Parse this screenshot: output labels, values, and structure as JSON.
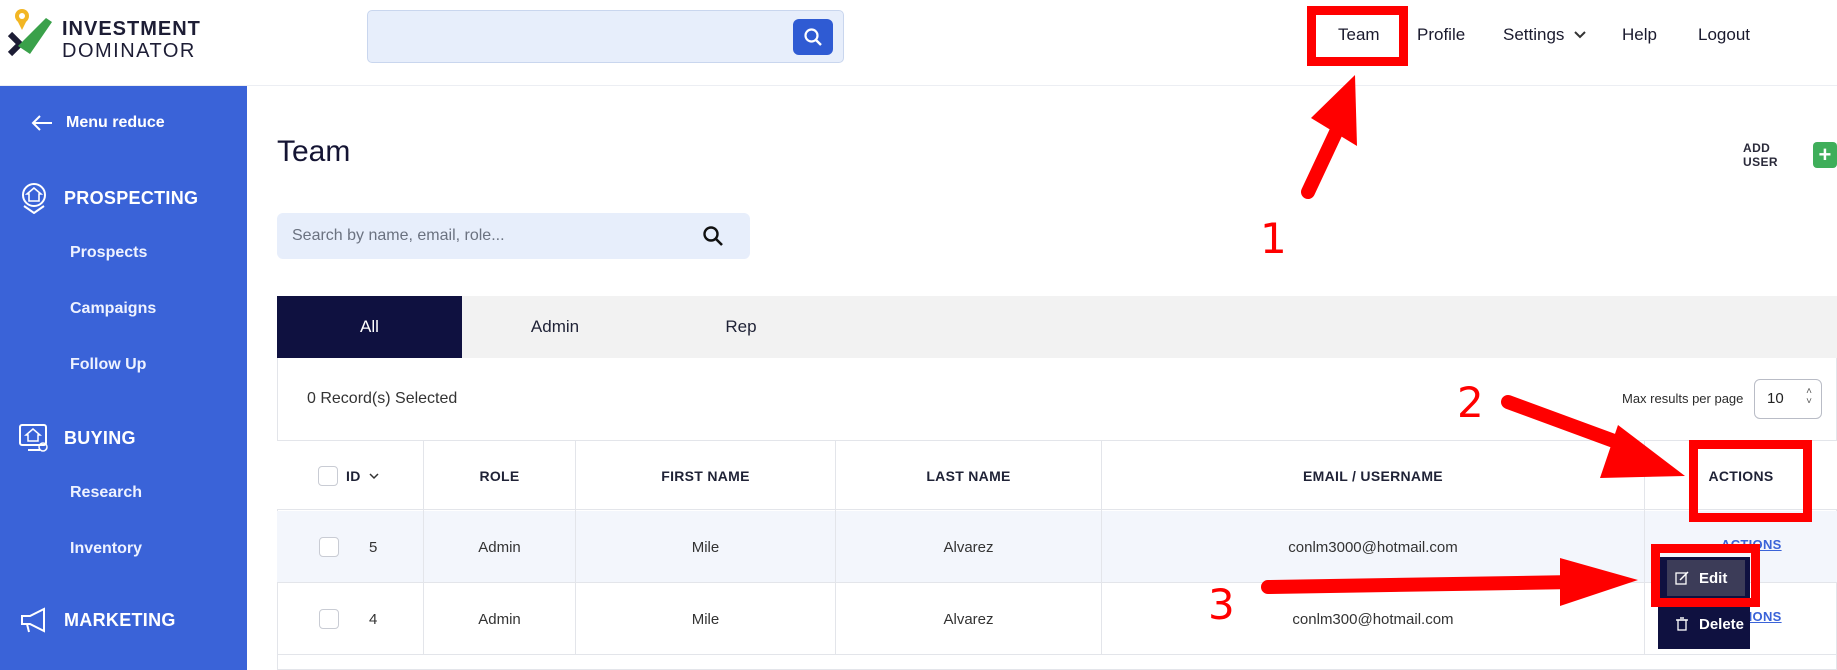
{
  "logo": {
    "line1": "INVESTMENT",
    "line2": "DOMINATOR"
  },
  "nav": {
    "team": "Team",
    "profile": "Profile",
    "settings": "Settings",
    "help": "Help",
    "logout": "Logout"
  },
  "sidebar": {
    "menu_reduce": "Menu reduce",
    "sections": [
      {
        "label": "PROSPECTING",
        "items": [
          "Prospects",
          "Campaigns",
          "Follow Up"
        ]
      },
      {
        "label": "BUYING",
        "items": [
          "Research",
          "Inventory"
        ]
      },
      {
        "label": "MARKETING",
        "items": []
      }
    ]
  },
  "main": {
    "title": "Team",
    "add_user": "ADD USER",
    "search_placeholder": "Search by name, email, role...",
    "tabs": [
      "All",
      "Admin",
      "Rep"
    ],
    "active_tab": "All",
    "selected_text": "0 Record(s) Selected",
    "max_results_label": "Max results per page",
    "page_size": "10"
  },
  "table": {
    "headers": [
      "ID",
      "ROLE",
      "FIRST NAME",
      "LAST NAME",
      "EMAIL / USERNAME",
      "ACTIONS"
    ],
    "rows": [
      {
        "id": "5",
        "role": "Admin",
        "first": "Mile",
        "last": "Alvarez",
        "email": "conlm3000@hotmail.com",
        "actions": "ACTIONS"
      },
      {
        "id": "4",
        "role": "Admin",
        "first": "Mile",
        "last": "Alvarez",
        "email": "conlm300@hotmail.com",
        "actions": "ACTIONS"
      }
    ]
  },
  "dropdown": {
    "edit": "Edit",
    "delete": "Delete"
  },
  "annotations": {
    "n1": "1",
    "n2": "2",
    "n3": "3"
  },
  "colors": {
    "sidebar": "#3a63d8",
    "active_tab": "#0f1140",
    "annotation": "#ff0000",
    "add_user": "#3fae5a"
  }
}
